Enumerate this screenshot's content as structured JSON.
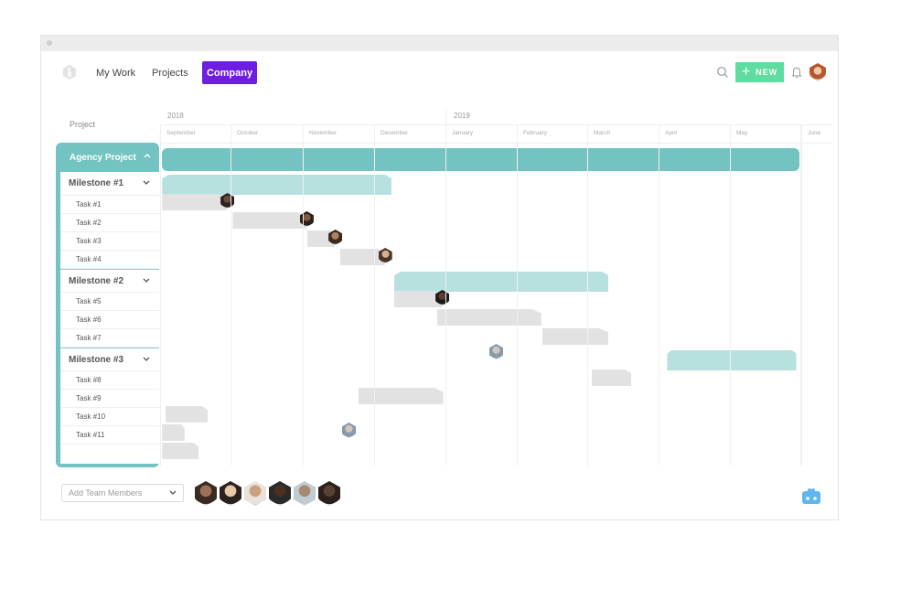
{
  "window": {
    "title": ""
  },
  "nav": {
    "logo": "hexagon-logo",
    "links": [
      {
        "label": "My Work",
        "active": false
      },
      {
        "label": "Projects",
        "active": false
      },
      {
        "label": "Company",
        "active": true
      }
    ],
    "new_button": {
      "icon": "plus-icon",
      "label": "NEW"
    },
    "icons": [
      "search-icon",
      "bell-icon",
      "user-avatar"
    ],
    "colors": {
      "active_tab": "#6d1ee0",
      "new_button": "#5fdc9f"
    }
  },
  "gantt": {
    "column_header": "Project",
    "years": [
      "2018",
      "2019"
    ],
    "months": [
      "September",
      "October",
      "November",
      "December",
      "January",
      "February",
      "March",
      "April",
      "May",
      "June"
    ],
    "project": {
      "name": "Agency Project",
      "expanded": true,
      "start_month": 0.03,
      "end_month": 8.97
    },
    "rows": [
      {
        "type": "milestone",
        "label": "Milestone #1",
        "start": 0.03,
        "end": 3.25
      },
      {
        "type": "task",
        "label": "Task #1",
        "start": 0.03,
        "end": 0.95,
        "avatar": "person-1"
      },
      {
        "type": "task",
        "label": "Task #2",
        "start": 1.03,
        "end": 2.05,
        "avatar": "person-2"
      },
      {
        "type": "task",
        "label": "Task #3",
        "start": 2.06,
        "end": 2.45,
        "avatar": "person-3"
      },
      {
        "type": "task",
        "label": "Task #4",
        "start": 2.52,
        "end": 3.15,
        "avatar": "person-4"
      },
      {
        "type": "milestone",
        "label": "Milestone #2",
        "start": 3.28,
        "end": 6.3
      },
      {
        "type": "task",
        "label": "Task #5",
        "start": 3.28,
        "end": 3.95,
        "avatar": "person-5"
      },
      {
        "type": "task",
        "label": "Task #6",
        "start": 3.88,
        "end": 5.35
      },
      {
        "type": "task",
        "label": "Task #7",
        "start": 5.36,
        "end": 6.3,
        "avatar_only": "person-6"
      },
      {
        "type": "milestone",
        "label": "Milestone #3",
        "start": 7.12,
        "end": 8.93
      },
      {
        "type": "task",
        "label": "Task #8",
        "start": 6.06,
        "end": 6.62
      },
      {
        "type": "task",
        "label": "Task #9",
        "start": 2.78,
        "end": 3.97
      },
      {
        "type": "task",
        "label": "Task #10",
        "start": 0.08,
        "end": 0.68
      },
      {
        "type": "task",
        "label": "Task #11",
        "start": 0.03,
        "end": 0.35
      },
      {
        "type": "task",
        "label": "",
        "start": 0.03,
        "end": 0.55,
        "avatar": "person-4b"
      }
    ],
    "colors": {
      "project": "#72c3c1",
      "milestone": "#b7e1df",
      "task": "#e2e2e2"
    }
  },
  "footer": {
    "team_select_placeholder": "Add Team Members",
    "team_members": [
      "member-1",
      "member-2",
      "member-3",
      "member-4",
      "member-5",
      "member-6"
    ],
    "bot_icon": "robot-icon"
  }
}
